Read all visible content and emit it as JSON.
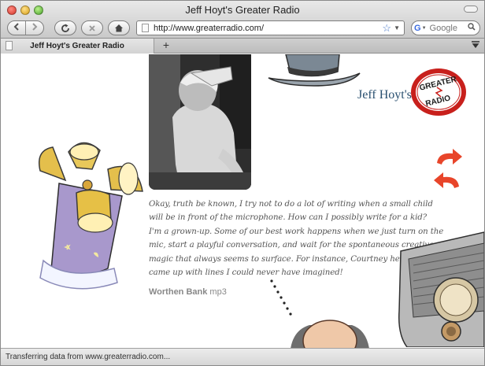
{
  "window": {
    "title": "Jeff Hoyt's Greater Radio"
  },
  "toolbar": {
    "back_icon": "chevron-left-icon",
    "forward_icon": "chevron-right-icon",
    "reload_icon": "reload-icon",
    "stop_icon": "stop-icon",
    "home_icon": "home-icon",
    "url": "http://www.greaterradio.com/",
    "search_placeholder": "Google"
  },
  "tabs": [
    {
      "label": "Jeff Hoyt's Greater Radio",
      "active": true
    }
  ],
  "page": {
    "logo_name": "Jeff Hoyt's",
    "logo_badge": {
      "line1": "GREATER",
      "line2": "RADIO"
    },
    "paragraph_lines": [
      "Okay, truth be known, I try not to do a lot of writing when a small child",
      "will be in front of the microphone. How can I possibly write for a kid?",
      "I'm a grown-up. Some of our best work happens when we just turn on the",
      "mic, start a playful conversation, and wait for the spontaneous creative",
      "magic that always seems to surface. For instance, Courtney here",
      "came up with lines I could never have imagined!"
    ],
    "audio_name": "Worthen Bank",
    "audio_type": "mp3"
  },
  "status": {
    "text": "Transferring data from www.greaterradio.com..."
  },
  "colors": {
    "logo_text": "#2a5070",
    "badge_red": "#c8201c",
    "arrow_red": "#e8452a",
    "body_text": "#555555"
  }
}
